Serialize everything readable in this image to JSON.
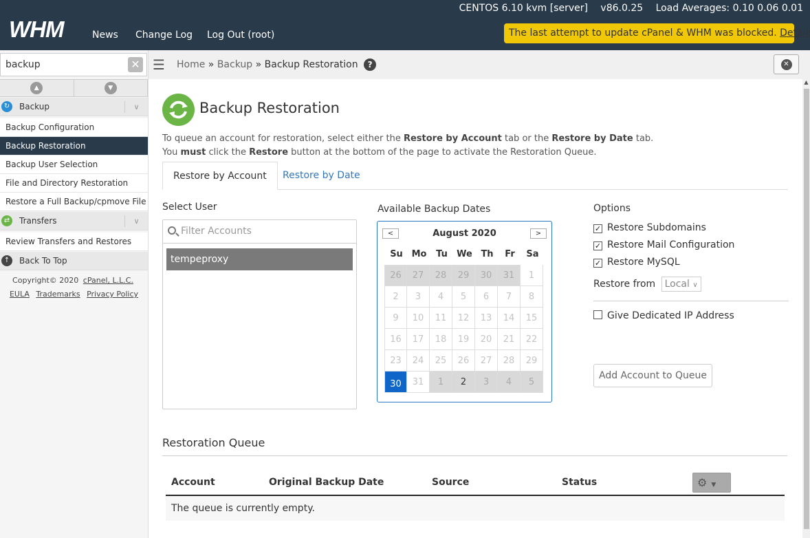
{
  "header": {
    "logo": "WHM",
    "nav": [
      "News",
      "Change Log",
      "Log Out (root)"
    ],
    "server_info": {
      "os": "CENTOS 6.10 kvm [server]",
      "version": "v86.0.25",
      "load": "Load Averages: 0.10 0.06 0.01"
    },
    "warning": {
      "text": "The last attempt to update cPanel & WHM was blocked.",
      "link": "Details",
      "color": "#f0c808"
    }
  },
  "sidebar": {
    "search_value": "backup",
    "sections": [
      {
        "name": "Backup",
        "icon": "backup-icon",
        "color": "#2a8fd6"
      },
      {
        "name": "Transfers",
        "icon": "transfers-icon",
        "color": "#6ab545"
      }
    ],
    "items": [
      "Backup Configuration",
      "Backup Restoration",
      "Backup User Selection",
      "File and Directory Restoration",
      "Restore a Full Backup/cpmove File",
      "Review Transfers and Restores"
    ],
    "back_to_top": "Back To Top",
    "copyright": "Copyright© 2020",
    "copyright_link": "cPanel, L.L.C.",
    "footer_links": [
      "EULA",
      "Trademarks",
      "Privacy Policy"
    ]
  },
  "breadcrumb": {
    "home": "Home",
    "sep": "»",
    "section": "Backup",
    "current": "Backup Restoration"
  },
  "page": {
    "title": "Backup Restoration",
    "desc1_a": "To queue an account for restoration, select either the ",
    "desc1_b": "Restore by Account",
    "desc1_c": " tab or the ",
    "desc1_d": "Restore by Date",
    "desc1_e": " tab.",
    "desc2_a": "You ",
    "desc2_b": "must",
    "desc2_c": " click the ",
    "desc2_d": "Restore",
    "desc2_e": " button at the bottom of the page to activate the Restoration Queue.",
    "tabs": [
      "Restore by Account",
      "Restore by Date"
    ],
    "select_user_label": "Select User",
    "filter_placeholder": "Filter Accounts",
    "users": [
      "tempeproxy"
    ],
    "dates_label": "Available Backup Dates",
    "options_label": "Options",
    "options": [
      {
        "label": "Restore Subdomains",
        "checked": true
      },
      {
        "label": "Restore Mail Configuration",
        "checked": true
      },
      {
        "label": "Restore MySQL",
        "checked": true
      }
    ],
    "restore_from_label": "Restore from",
    "restore_from_value": "Local",
    "dedicated_ip": {
      "label": "Give Dedicated IP Address",
      "checked": false
    },
    "add_button": "Add Account to Queue",
    "queue_title": "Restoration Queue",
    "columns": [
      "Account",
      "Original Backup Date",
      "Source",
      "Status"
    ],
    "empty_text": "The queue is currently empty."
  },
  "calendar": {
    "month": "August 2020",
    "weekdays": [
      "Su",
      "Mo",
      "Tu",
      "We",
      "Th",
      "Fr",
      "Sa"
    ],
    "weeks": [
      [
        26,
        27,
        28,
        29,
        30,
        31,
        1
      ],
      [
        2,
        3,
        4,
        5,
        6,
        7,
        8
      ],
      [
        9,
        10,
        11,
        12,
        13,
        14,
        15
      ],
      [
        16,
        17,
        18,
        19,
        20,
        21,
        22
      ],
      [
        23,
        24,
        25,
        26,
        27,
        28,
        29
      ],
      [
        30,
        31,
        1,
        2,
        3,
        4,
        5
      ]
    ],
    "selected_day": 30,
    "available_day": 2,
    "selected_color": "#0f66c8"
  }
}
